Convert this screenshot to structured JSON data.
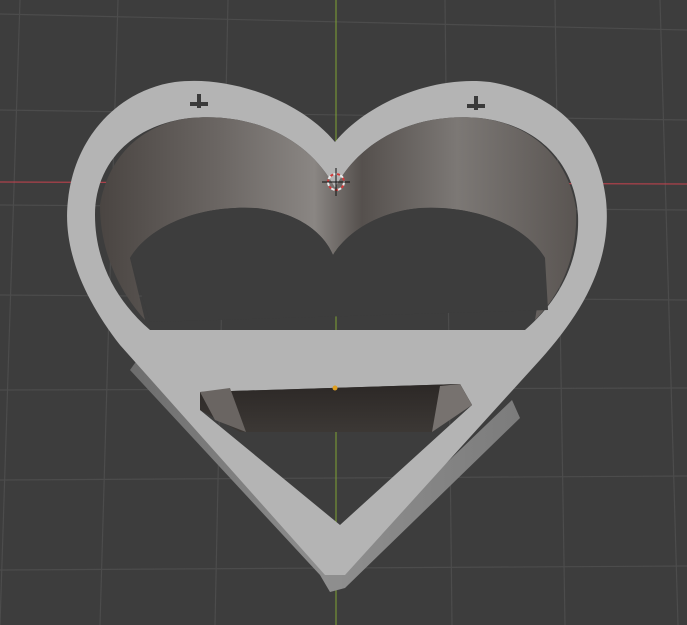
{
  "viewport": {
    "view": "3d-viewport",
    "colors": {
      "background": "#3d3d3d",
      "grid": "#4c4c4c",
      "x_axis": "#c8424e",
      "y_axis": "#7fa334",
      "mesh_top": "#b6b6b6",
      "mesh_wall_light": "#7a7673",
      "mesh_wall_dark": "#3a3532",
      "origin_point": "#e0a020"
    },
    "objects": [
      {
        "name": "heart-ring-mesh",
        "type": "mesh"
      }
    ]
  }
}
